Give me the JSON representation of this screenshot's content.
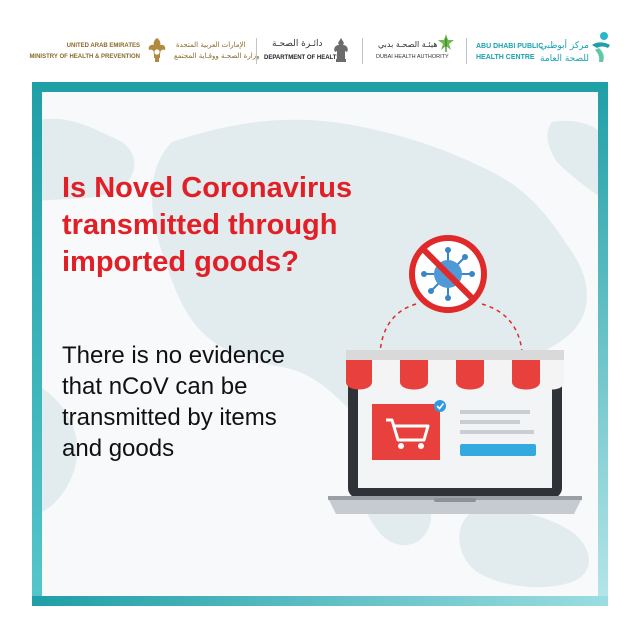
{
  "header": {
    "moh": {
      "en_line1": "UNITED ARAB EMIRATES",
      "en_line2": "MINISTRY OF HEALTH & PREVENTION",
      "ar_line1": "الإمارات العربية المتحدة",
      "ar_line2": "وزارة الصحـة ووقـاية المجتمع",
      "emblem_icon": "uae-falcon-emblem-icon"
    },
    "doh": {
      "ar": "دائـرة الصحـة",
      "en": "DEPARTMENT OF HEALTH",
      "emblem_icon": "abu-dhabi-emblem-icon"
    },
    "dha": {
      "ar": "هيئـة الصحـة بدبي",
      "en": "DUBAI HEALTH AUTHORITY",
      "icon": "dha-leaf-icon"
    },
    "adphc": {
      "en_line1": "ABU DHABI PUBLIC",
      "en_line2": "HEALTH CENTRE",
      "ar_line1": "مركز أبوظبي",
      "ar_line2": "للصحة العامة",
      "icon": "adphc-figure-icon"
    }
  },
  "content": {
    "headline": "Is Novel Coronavirus transmitted through imported goods?",
    "body": "There is no evidence that nCoV can be transmitted by items and goods"
  },
  "illustration": {
    "laptop_icon": "laptop-shop-icon",
    "cart_icon": "shopping-cart-icon",
    "virus_icon": "virus-prohibited-icon",
    "check_icon": "check-badge-icon"
  },
  "colors": {
    "headline": "#e11f26",
    "border_teal": "#1f9fa6",
    "awning_red": "#e8403c",
    "prohibit_red": "#e02a2a",
    "virus_blue": "#3b86c7"
  }
}
